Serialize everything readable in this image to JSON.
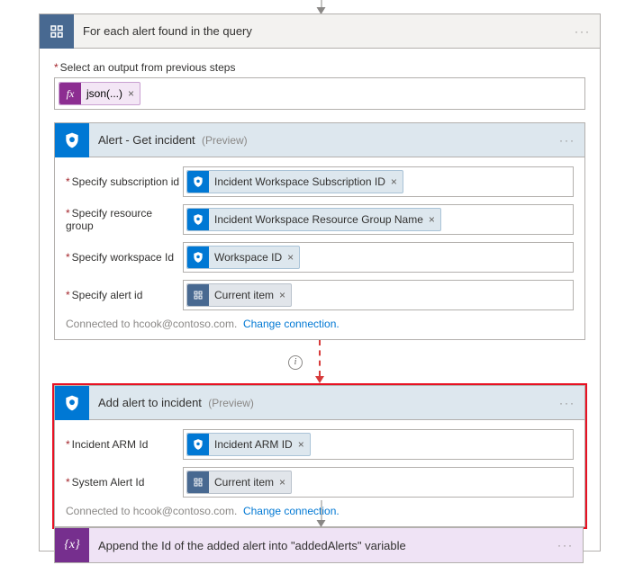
{
  "foreach": {
    "title": "For each alert found in the query",
    "select_label": "Select an output from previous steps",
    "fx_label": "fx",
    "fx_token": "json(...)"
  },
  "get_incident": {
    "title": "Alert - Get incident",
    "preview": "(Preview)",
    "params": {
      "subscription_label": "Specify subscription id",
      "subscription_token": "Incident Workspace Subscription ID",
      "rg_label": "Specify resource group",
      "rg_token": "Incident Workspace Resource Group Name",
      "workspace_label": "Specify workspace Id",
      "workspace_token": "Workspace ID",
      "alert_label": "Specify alert id",
      "alert_token": "Current item"
    },
    "connection_text": "Connected to hcook@contoso.com.",
    "change_link": "Change connection."
  },
  "add_alert": {
    "title": "Add alert to incident",
    "preview": "(Preview)",
    "params": {
      "arm_label": "Incident ARM Id",
      "arm_token": "Incident ARM ID",
      "sys_label": "System Alert Id",
      "sys_token": "Current item"
    },
    "connection_text": "Connected to hcook@contoso.com.",
    "change_link": "Change connection."
  },
  "append": {
    "title": "Append the Id of the added alert into \"addedAlerts\" variable"
  },
  "info_char": "i",
  "close_char": "×",
  "more_char": "···"
}
